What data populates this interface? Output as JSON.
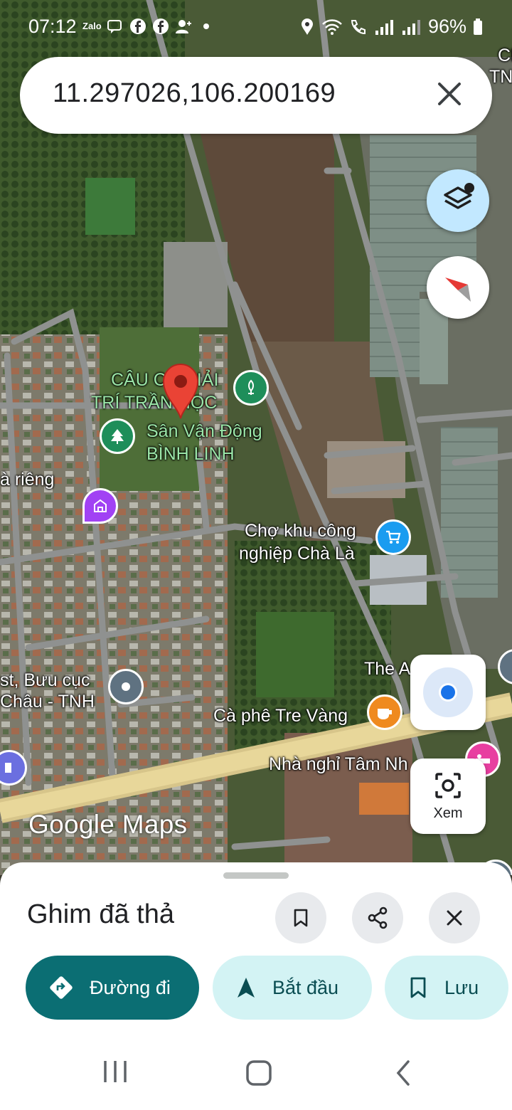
{
  "status_bar": {
    "time": "07:12",
    "app_icons": [
      "Zalo",
      "chat-icon",
      "facebook-icon",
      "facebook-icon",
      "add-contact-icon",
      "dot-icon"
    ],
    "battery": "96%"
  },
  "search": {
    "query": "11.297026,106.200169"
  },
  "map_labels": {
    "poi_fish": "CÂU CÁ GIẢI TRÍ TRẦN HỌC",
    "poi_fish_line1": "CÂU CÁ GIẢI",
    "poi_fish_line2": "TRÍ TRẦN HỌC",
    "stadium_line1": "Sân Vận Động",
    "stadium_line2": "BÌNH LINH",
    "rieng": "à riêng",
    "market_line1": "Chợ khu công",
    "market_line2": "nghiệp Chà Là",
    "post_line1": "st, Bưu cục",
    "post_line2": "Châu - TNH",
    "the_a": "The A",
    "cafe": "Cà phê Tre Vàng",
    "hotel": "Nhà nghỉ Tâm Nh",
    "edge_ci": "CI",
    "edge_tn": "TN"
  },
  "logo": {
    "google": "Google",
    "maps": "Maps"
  },
  "lens_button": {
    "label": "Xem"
  },
  "bottom_sheet": {
    "title": "Ghim đã thả",
    "directions": "Đường đi",
    "start": "Bắt đầu",
    "save": "Lưu"
  },
  "colors": {
    "primary_button": "#0b6e73",
    "secondary_button": "#d3f3f4",
    "pin": "#ea4335",
    "route": "#e8d79a",
    "location_dot": "#1a73e8"
  }
}
